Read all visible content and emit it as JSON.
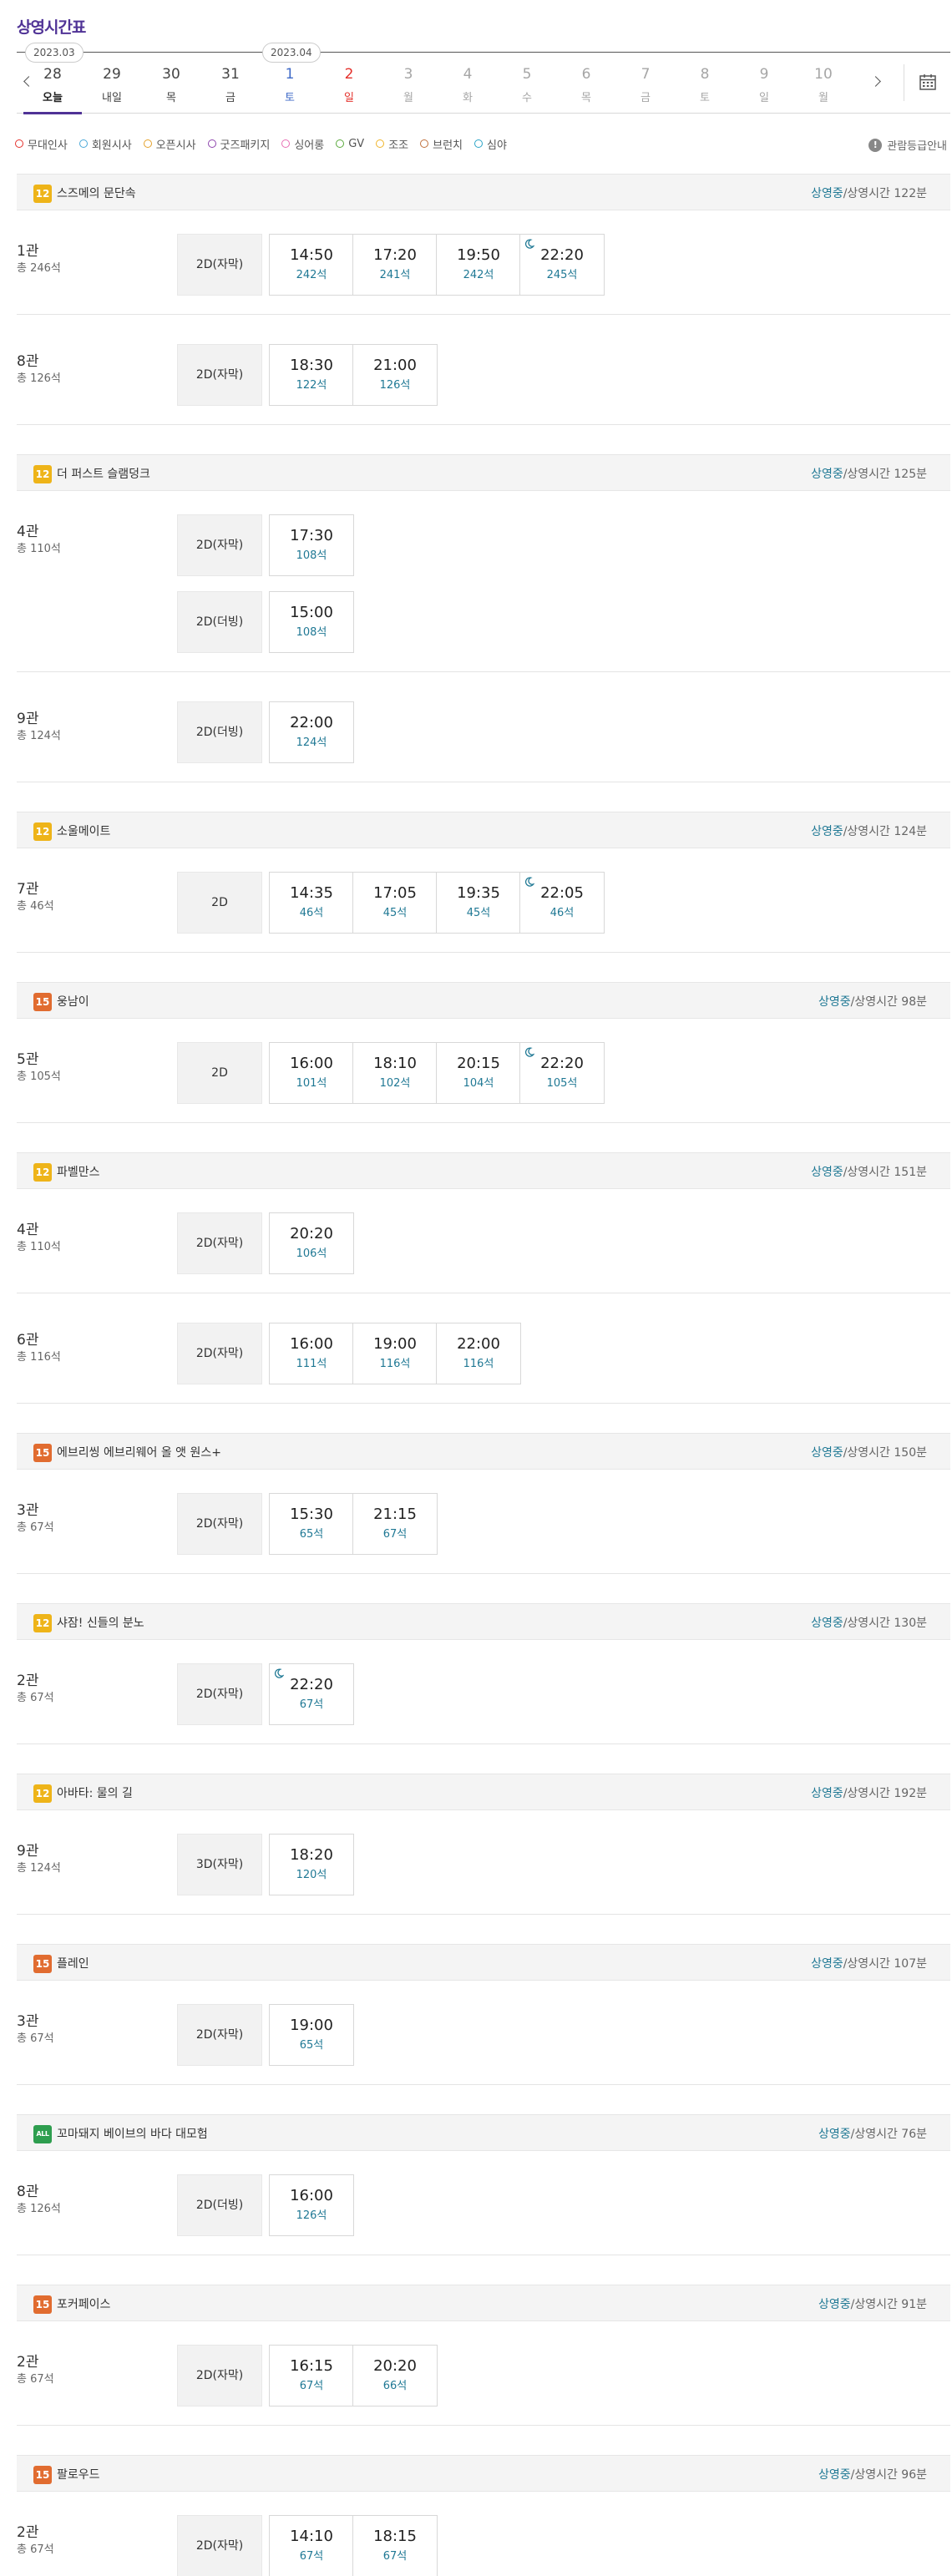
{
  "page_title": "상영시간표",
  "colors": {
    "accent": "#503396",
    "seat_text": "#1f7894",
    "saturday": "#3f6ac7",
    "sunday": "#e4312c"
  },
  "dates": [
    {
      "num": "28",
      "day": "오늘",
      "style": "normal",
      "selected": true,
      "month_badge": "2023.03"
    },
    {
      "num": "29",
      "day": "내일",
      "style": "normal"
    },
    {
      "num": "30",
      "day": "목",
      "style": "normal"
    },
    {
      "num": "31",
      "day": "금",
      "style": "normal"
    },
    {
      "num": "1",
      "day": "토",
      "style": "sat",
      "month_badge": "2023.04"
    },
    {
      "num": "2",
      "day": "일",
      "style": "sun"
    },
    {
      "num": "3",
      "day": "월",
      "style": "off"
    },
    {
      "num": "4",
      "day": "화",
      "style": "off"
    },
    {
      "num": "5",
      "day": "수",
      "style": "off"
    },
    {
      "num": "6",
      "day": "목",
      "style": "off"
    },
    {
      "num": "7",
      "day": "금",
      "style": "off"
    },
    {
      "num": "8",
      "day": "토",
      "style": "off"
    },
    {
      "num": "9",
      "day": "일",
      "style": "off"
    },
    {
      "num": "10",
      "day": "월",
      "style": "off"
    }
  ],
  "legend": [
    {
      "label": "무대인사",
      "icon": "stage-greeting-icon",
      "color": "#e4312c"
    },
    {
      "label": "회원시사",
      "icon": "member-preview-icon",
      "color": "#4aa8d8"
    },
    {
      "label": "오픈시사",
      "icon": "open-preview-icon",
      "color": "#e4a22c"
    },
    {
      "label": "굿즈패키지",
      "icon": "goods-package-icon",
      "color": "#8e44ad"
    },
    {
      "label": "싱어롱",
      "icon": "singalong-icon",
      "color": "#e86fb4"
    },
    {
      "label": "GV",
      "icon": "gv-icon",
      "color": "#5aaa3c"
    },
    {
      "label": "조조",
      "icon": "early-morning-icon",
      "color": "#f0b429"
    },
    {
      "label": "브런치",
      "icon": "brunch-icon",
      "color": "#c0703c"
    },
    {
      "label": "심야",
      "icon": "late-night-icon",
      "color": "#2aa4c7"
    }
  ],
  "rating_guide": "관람등급안내",
  "info_prefix_status": "상영중",
  "info_sep": "/",
  "movies": [
    {
      "age": "12",
      "age_color": "#eeb419",
      "title": "스즈메의 문단속",
      "runtime": "상영시간 122분",
      "screens": [
        {
          "hall": "1관",
          "seats": "총 246석",
          "rows": [
            {
              "format": "2D(자막)",
              "times": [
                {
                  "time": "14:50",
                  "seat": "242석"
                },
                {
                  "time": "17:20",
                  "seat": "241석"
                },
                {
                  "time": "19:50",
                  "seat": "242석"
                },
                {
                  "time": "22:20",
                  "seat": "245석",
                  "night": true
                }
              ]
            }
          ]
        },
        {
          "hall": "8관",
          "seats": "총 126석",
          "rows": [
            {
              "format": "2D(자막)",
              "times": [
                {
                  "time": "18:30",
                  "seat": "122석"
                },
                {
                  "time": "21:00",
                  "seat": "126석"
                }
              ]
            }
          ]
        }
      ]
    },
    {
      "age": "12",
      "age_color": "#eeb419",
      "title": "더 퍼스트 슬램덩크",
      "runtime": "상영시간 125분",
      "screens": [
        {
          "hall": "4관",
          "seats": "총 110석",
          "rows": [
            {
              "format": "2D(자막)",
              "times": [
                {
                  "time": "17:30",
                  "seat": "108석"
                }
              ]
            },
            {
              "format": "2D(더빙)",
              "times": [
                {
                  "time": "15:00",
                  "seat": "108석"
                }
              ]
            }
          ]
        },
        {
          "hall": "9관",
          "seats": "총 124석",
          "rows": [
            {
              "format": "2D(더빙)",
              "times": [
                {
                  "time": "22:00",
                  "seat": "124석"
                }
              ]
            }
          ]
        }
      ]
    },
    {
      "age": "12",
      "age_color": "#eeb419",
      "title": "소울메이트",
      "runtime": "상영시간 124분",
      "screens": [
        {
          "hall": "7관",
          "seats": "총 46석",
          "rows": [
            {
              "format": "2D",
              "times": [
                {
                  "time": "14:35",
                  "seat": "46석"
                },
                {
                  "time": "17:05",
                  "seat": "45석"
                },
                {
                  "time": "19:35",
                  "seat": "45석"
                },
                {
                  "time": "22:05",
                  "seat": "46석",
                  "night": true
                }
              ]
            }
          ]
        }
      ]
    },
    {
      "age": "15",
      "age_color": "#e16c30",
      "title": "웅남이",
      "runtime": "상영시간 98분",
      "screens": [
        {
          "hall": "5관",
          "seats": "총 105석",
          "rows": [
            {
              "format": "2D",
              "times": [
                {
                  "time": "16:00",
                  "seat": "101석"
                },
                {
                  "time": "18:10",
                  "seat": "102석"
                },
                {
                  "time": "20:15",
                  "seat": "104석"
                },
                {
                  "time": "22:20",
                  "seat": "105석",
                  "night": true
                }
              ]
            }
          ]
        }
      ]
    },
    {
      "age": "12",
      "age_color": "#eeb419",
      "title": "파벨만스",
      "runtime": "상영시간 151분",
      "screens": [
        {
          "hall": "4관",
          "seats": "총 110석",
          "rows": [
            {
              "format": "2D(자막)",
              "times": [
                {
                  "time": "20:20",
                  "seat": "106석"
                }
              ]
            }
          ]
        },
        {
          "hall": "6관",
          "seats": "총 116석",
          "rows": [
            {
              "format": "2D(자막)",
              "times": [
                {
                  "time": "16:00",
                  "seat": "111석"
                },
                {
                  "time": "19:00",
                  "seat": "116석"
                },
                {
                  "time": "22:00",
                  "seat": "116석"
                }
              ]
            }
          ]
        }
      ]
    },
    {
      "age": "15",
      "age_color": "#e16c30",
      "title": "에브리씽 에브리웨어 올 앳 원스+",
      "runtime": "상영시간 150분",
      "screens": [
        {
          "hall": "3관",
          "seats": "총 67석",
          "rows": [
            {
              "format": "2D(자막)",
              "times": [
                {
                  "time": "15:30",
                  "seat": "65석"
                },
                {
                  "time": "21:15",
                  "seat": "67석"
                }
              ]
            }
          ]
        }
      ]
    },
    {
      "age": "12",
      "age_color": "#eeb419",
      "title": "샤잠! 신들의 분노",
      "runtime": "상영시간 130분",
      "screens": [
        {
          "hall": "2관",
          "seats": "총 67석",
          "rows": [
            {
              "format": "2D(자막)",
              "times": [
                {
                  "time": "22:20",
                  "seat": "67석",
                  "night": true
                }
              ]
            }
          ]
        }
      ]
    },
    {
      "age": "12",
      "age_color": "#eeb419",
      "title": "아바타: 물의 길",
      "runtime": "상영시간 192분",
      "screens": [
        {
          "hall": "9관",
          "seats": "총 124석",
          "rows": [
            {
              "format": "3D(자막)",
              "times": [
                {
                  "time": "18:20",
                  "seat": "120석"
                }
              ]
            }
          ]
        }
      ]
    },
    {
      "age": "15",
      "age_color": "#e16c30",
      "title": "플레인",
      "runtime": "상영시간 107분",
      "screens": [
        {
          "hall": "3관",
          "seats": "총 67석",
          "rows": [
            {
              "format": "2D(자막)",
              "times": [
                {
                  "time": "19:00",
                  "seat": "65석"
                }
              ]
            }
          ]
        }
      ]
    },
    {
      "age": "ALL",
      "age_color": "#2e9e4f",
      "title": "꼬마돼지 베이브의 바다 대모험",
      "runtime": "상영시간 76분",
      "screens": [
        {
          "hall": "8관",
          "seats": "총 126석",
          "rows": [
            {
              "format": "2D(더빙)",
              "times": [
                {
                  "time": "16:00",
                  "seat": "126석"
                }
              ]
            }
          ]
        }
      ]
    },
    {
      "age": "15",
      "age_color": "#e16c30",
      "title": "포커페이스",
      "runtime": "상영시간 91분",
      "screens": [
        {
          "hall": "2관",
          "seats": "총 67석",
          "rows": [
            {
              "format": "2D(자막)",
              "times": [
                {
                  "time": "16:15",
                  "seat": "67석"
                },
                {
                  "time": "20:20",
                  "seat": "66석"
                }
              ]
            }
          ]
        }
      ]
    },
    {
      "age": "15",
      "age_color": "#e16c30",
      "title": "팔로우드",
      "runtime": "상영시간 96분",
      "screens": [
        {
          "hall": "2관",
          "seats": "총 67석",
          "rows": [
            {
              "format": "2D(자막)",
              "times": [
                {
                  "time": "14:10",
                  "seat": "67석"
                },
                {
                  "time": "18:15",
                  "seat": "67석"
                }
              ]
            }
          ]
        }
      ]
    }
  ]
}
